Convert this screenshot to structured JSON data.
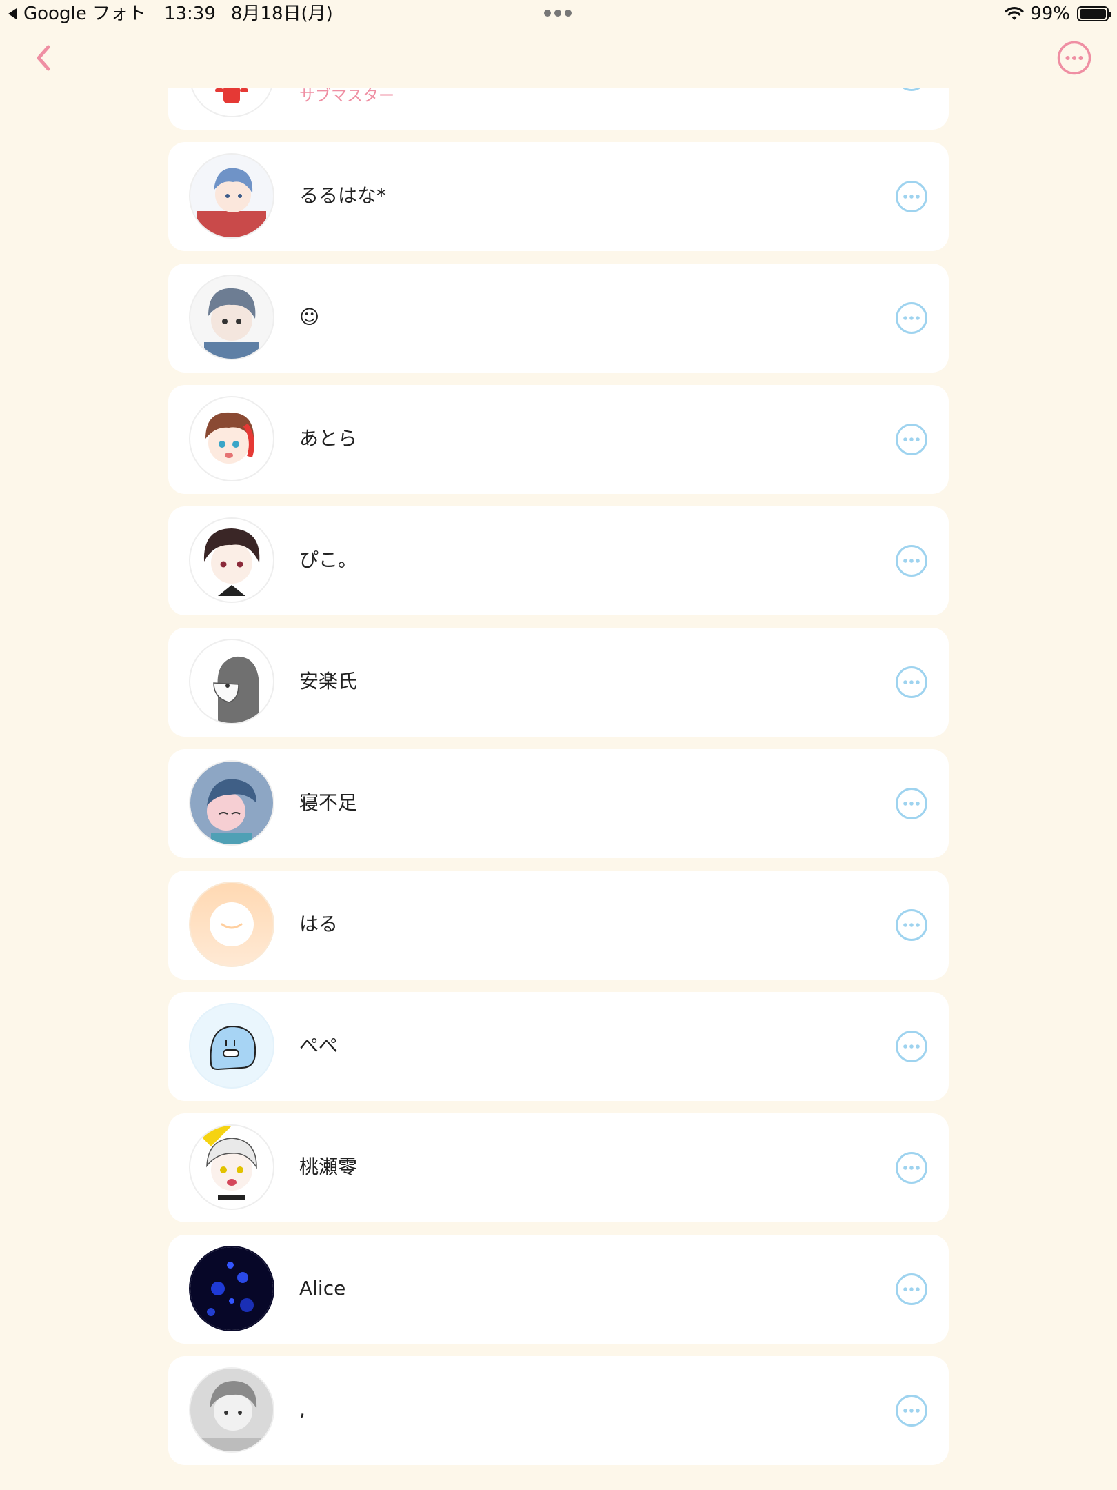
{
  "status_bar": {
    "back_app": "Google フォト",
    "time": "13:39",
    "date": "8月18日(月)",
    "battery": "99%"
  },
  "nav": {
    "back_icon": "chevron-left-icon",
    "more_icon": "more-icon"
  },
  "colors": {
    "background": "#fdf7ea",
    "accent_pink": "#ef8fa3",
    "row_more_blue": "#9ed3ef"
  },
  "members": [
    {
      "name": "",
      "role": "サブマスター"
    },
    {
      "name": "るるはな*",
      "role": ""
    },
    {
      "name": "☺",
      "role": ""
    },
    {
      "name": "あとら",
      "role": ""
    },
    {
      "name": "ぴこ。",
      "role": ""
    },
    {
      "name": "安楽氏",
      "role": ""
    },
    {
      "name": "寝不足",
      "role": ""
    },
    {
      "name": "はる",
      "role": ""
    },
    {
      "name": "ぺぺ",
      "role": ""
    },
    {
      "name": "桃瀬零",
      "role": ""
    },
    {
      "name": "Alice",
      "role": ""
    },
    {
      "name": ",",
      "role": ""
    }
  ]
}
